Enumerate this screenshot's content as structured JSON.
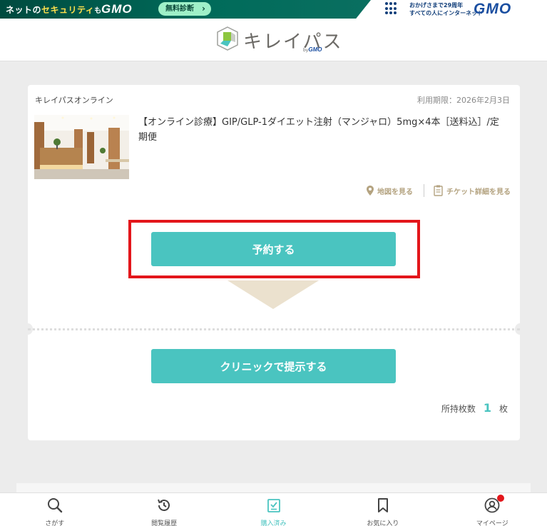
{
  "banner": {
    "left_text_part1": "ネットの",
    "left_text_highlight": "セキュリティ",
    "left_text_part2": "も",
    "left_brand": "GMO",
    "pill_label": "無料診断",
    "right_line1": "おかげさまで29周年",
    "right_line2": "すべての人にインターネット",
    "right_brand": "GMO"
  },
  "header": {
    "logo_text": "キレイパス",
    "logo_by": "by",
    "logo_by_brand": "GMO"
  },
  "ticket": {
    "provider": "キレイパスオンライン",
    "expiry": "利用期限：2026年2月3日",
    "title": "【オンライン診療】GIP/GLP-1ダイエット注射（マンジャロ）5mg×4本［送料込］/定期便",
    "map_link": "地図を見る",
    "detail_link": "チケット詳細を見る",
    "reserve_button": "予約する",
    "present_button": "クリニックで提示する",
    "count_label": "所持枚数",
    "count_value": "1",
    "count_unit": "枚"
  },
  "bottom_nav": {
    "items": [
      {
        "label": "さがす",
        "icon": "search-icon"
      },
      {
        "label": "閲覧履歴",
        "icon": "history-icon"
      },
      {
        "label": "購入済み",
        "icon": "purchased-icon",
        "active": true
      },
      {
        "label": "お気に入り",
        "icon": "bookmark-icon"
      },
      {
        "label": "マイページ",
        "icon": "user-icon",
        "badge": true
      }
    ]
  },
  "colors": {
    "accent": "#4ac4c0",
    "highlight_red": "#e3161b",
    "gold_link": "#b4a380",
    "background": "#ececec"
  }
}
